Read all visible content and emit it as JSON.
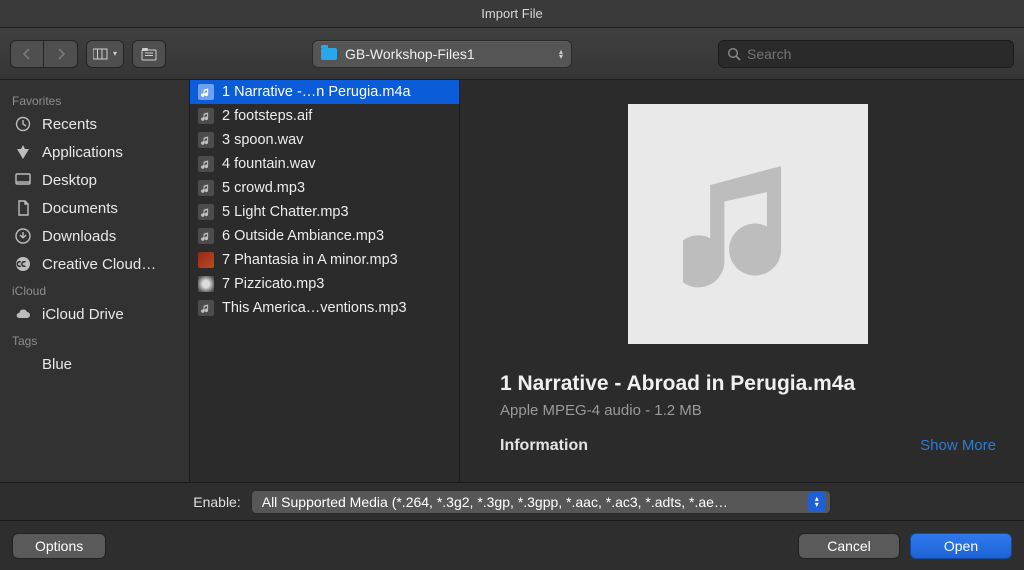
{
  "window_title": "Import File",
  "toolbar": {
    "folder_name": "GB-Workshop-Files1",
    "search_placeholder": "Search"
  },
  "sidebar": {
    "sections": [
      {
        "title": "Favorites",
        "items": [
          {
            "icon": "recents",
            "label": "Recents"
          },
          {
            "icon": "applications",
            "label": "Applications"
          },
          {
            "icon": "desktop",
            "label": "Desktop"
          },
          {
            "icon": "documents",
            "label": "Documents"
          },
          {
            "icon": "downloads",
            "label": "Downloads"
          },
          {
            "icon": "cc",
            "label": "Creative Cloud…"
          }
        ]
      },
      {
        "title": "iCloud",
        "items": [
          {
            "icon": "icloud",
            "label": "iCloud Drive"
          }
        ]
      },
      {
        "title": "Tags",
        "items": [
          {
            "icon": "tag-blue",
            "label": "Blue"
          }
        ]
      }
    ]
  },
  "files": [
    {
      "selected": true,
      "icon": "audio",
      "label": "1 Narrative -…n Perugia.m4a"
    },
    {
      "selected": false,
      "icon": "audio",
      "label": "2 footsteps.aif"
    },
    {
      "selected": false,
      "icon": "audio",
      "label": "3 spoon.wav"
    },
    {
      "selected": false,
      "icon": "audio",
      "label": "4 fountain.wav"
    },
    {
      "selected": false,
      "icon": "audio",
      "label": "5 crowd.mp3"
    },
    {
      "selected": false,
      "icon": "audio",
      "label": "5 Light Chatter.mp3"
    },
    {
      "selected": false,
      "icon": "audio",
      "label": "6 Outside Ambiance.mp3"
    },
    {
      "selected": false,
      "icon": "art-red",
      "label": "7 Phantasia in A minor.mp3"
    },
    {
      "selected": false,
      "icon": "art-bw",
      "label": "7 Pizzicato.mp3"
    },
    {
      "selected": false,
      "icon": "audio",
      "label": "This America…ventions.mp3"
    }
  ],
  "preview": {
    "title": "1 Narrative - Abroad in Perugia.m4a",
    "subtitle": "Apple MPEG-4 audio - 1.2 MB",
    "info_heading": "Information",
    "show_more": "Show More"
  },
  "filter": {
    "label": "Enable:",
    "value": "All Supported Media (*.264, *.3g2, *.3gp, *.3gpp, *.aac, *.ac3, *.adts, *.ae…"
  },
  "buttons": {
    "options": "Options",
    "cancel": "Cancel",
    "open": "Open"
  }
}
